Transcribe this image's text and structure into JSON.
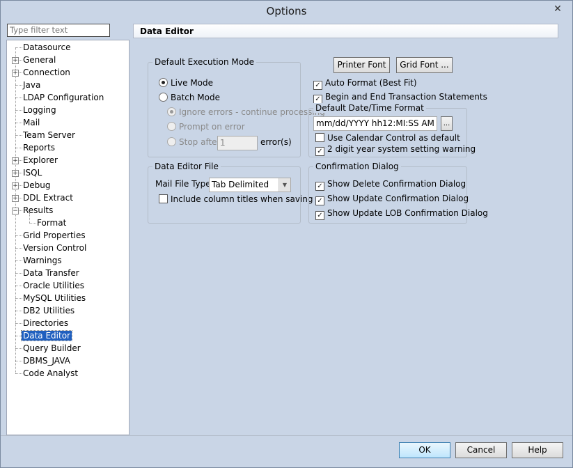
{
  "window": {
    "title": "Options",
    "close_glyph": "✕"
  },
  "filter": {
    "placeholder": "Type filter text"
  },
  "tree": [
    {
      "label": "Datasource",
      "expander": false
    },
    {
      "label": "General",
      "expander": "+"
    },
    {
      "label": "Connection",
      "expander": "+"
    },
    {
      "label": "Java",
      "expander": false
    },
    {
      "label": "LDAP Configuration",
      "expander": false
    },
    {
      "label": "Logging",
      "expander": false
    },
    {
      "label": "Mail",
      "expander": false
    },
    {
      "label": "Team Server",
      "expander": false
    },
    {
      "label": "Reports",
      "expander": false
    },
    {
      "label": "Explorer",
      "expander": "+"
    },
    {
      "label": "ISQL",
      "expander": "+"
    },
    {
      "label": "Debug",
      "expander": "+"
    },
    {
      "label": "DDL Extract",
      "expander": "+"
    },
    {
      "label": "Results",
      "expander": "−"
    },
    {
      "label": "Format",
      "expander": false,
      "child": true
    },
    {
      "label": "Grid Properties",
      "expander": false
    },
    {
      "label": "Version Control",
      "expander": false
    },
    {
      "label": "Warnings",
      "expander": false
    },
    {
      "label": "Data Transfer",
      "expander": false
    },
    {
      "label": "Oracle Utilities",
      "expander": false
    },
    {
      "label": "MySQL Utilities",
      "expander": false
    },
    {
      "label": "DB2 Utilities",
      "expander": false
    },
    {
      "label": "Directories",
      "expander": false
    },
    {
      "label": "Data Editor",
      "expander": false,
      "selected": true
    },
    {
      "label": "Query Builder",
      "expander": false
    },
    {
      "label": "DBMS_JAVA",
      "expander": false
    },
    {
      "label": "Code Analyst",
      "expander": false
    }
  ],
  "header": {
    "title": "Data Editor"
  },
  "exec_mode": {
    "title": "Default Execution Mode",
    "live": "Live Mode",
    "batch": "Batch Mode",
    "ignore": "Ignore errors - continue processing",
    "prompt": "Prompt on error",
    "stop": "Stop after",
    "stop_value": "1",
    "errors_suffix": "error(s)"
  },
  "buttons": {
    "printer_font": "Printer Font ...",
    "grid_font": "Grid Font ...",
    "ok": "OK",
    "cancel": "Cancel",
    "help": "Help"
  },
  "checks": {
    "auto_format": "Auto Format (Best Fit)",
    "begin_end": "Begin and End Transaction Statements"
  },
  "date_format": {
    "title": "Default Date/Time Format",
    "value": "mm/dd/YYYY hh12:MI:SS AM",
    "browse": "...",
    "use_calendar": "Use Calendar Control as default",
    "two_digit": "2 digit year system setting warning"
  },
  "data_editor_file": {
    "title": "Data Editor File",
    "mail_label": "Mail File Type:",
    "mail_value": "Tab Delimited",
    "include_titles": "Include column titles when saving"
  },
  "confirmation": {
    "title": "Confirmation Dialog",
    "delete": "Show Delete Confirmation Dialog",
    "update": "Show Update Confirmation Dialog",
    "update_lob": "Show Update LOB Confirmation Dialog"
  },
  "icons": {
    "check": "✓",
    "combo_arrow": "▼"
  }
}
